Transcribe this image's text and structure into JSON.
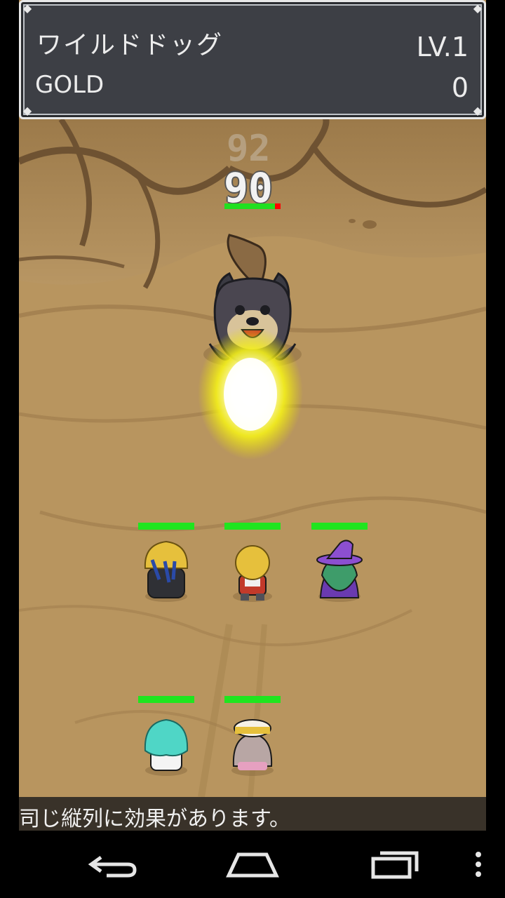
{
  "status": {
    "enemy_name": "ワイルドドッグ",
    "level": "LV.1",
    "gold_label": "GOLD",
    "gold_value": "0"
  },
  "battle": {
    "damage_previous": "92",
    "damage_current": "90",
    "enemy_hp_fraction": 0.9,
    "party": [
      {
        "slot": "front-left",
        "hp_fraction": 1.0
      },
      {
        "slot": "front-center",
        "hp_fraction": 1.0
      },
      {
        "slot": "front-right",
        "hp_fraction": 1.0
      },
      {
        "slot": "back-left",
        "hp_fraction": 1.0
      },
      {
        "slot": "back-center",
        "hp_fraction": 1.0
      }
    ]
  },
  "message": "司じ縦列に効果があります。",
  "navbar": {
    "icons": [
      "back-icon",
      "home-icon",
      "recent-apps-icon",
      "menu-icon"
    ]
  },
  "colors": {
    "hp_green": "#1fe51f",
    "hp_red": "#ff0000",
    "panel_bg": "#3d3f45",
    "ground": "#b08c58"
  }
}
